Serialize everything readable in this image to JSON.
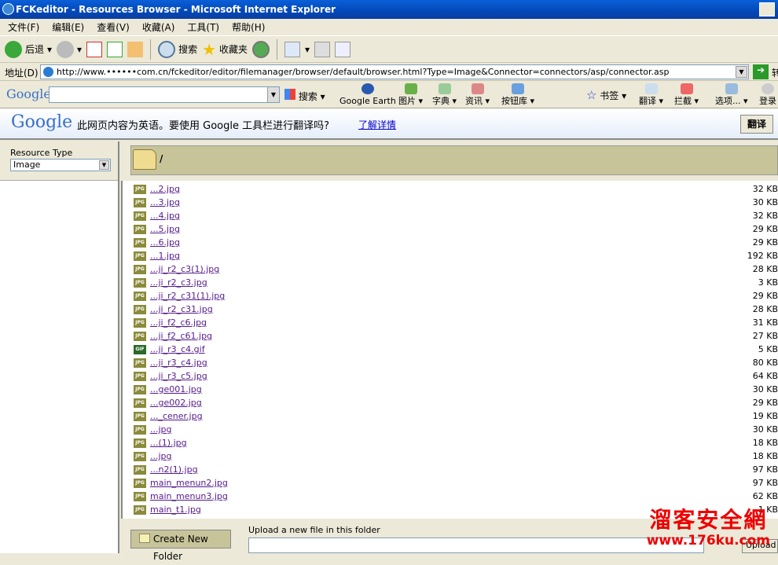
{
  "window": {
    "title": "FCKeditor - Resources Browser - Microsoft Internet Explorer"
  },
  "menu": [
    "文件(F)",
    "编辑(E)",
    "查看(V)",
    "收藏(A)",
    "工具(T)",
    "帮助(H)"
  ],
  "toolbar": {
    "back": "后退",
    "search": "搜索",
    "favorites": "收藏夹"
  },
  "address": {
    "label": "地址(D)",
    "url": "http://www.••••••com.cn/fckeditor/editor/filemanager/browser/default/browser.html?Type=Image&Connector=connectors/asp/connector.asp",
    "go": "转"
  },
  "google_toolbar": {
    "logo": "Google",
    "search": "搜索",
    "items": [
      "Google Earth",
      "图片",
      "字典",
      "资讯",
      "按钮库",
      "书签",
      "翻译",
      "拦截",
      "选项...",
      "登录"
    ]
  },
  "translate_bar": {
    "logo": "Google",
    "message": "此网页内容为英语。要使用 Google 工具栏进行翻译吗?",
    "learn_more": "了解详情",
    "button": "翻译"
  },
  "resource_type": {
    "label": "Resource Type",
    "value": "Image"
  },
  "folder": {
    "path": "/"
  },
  "files": [
    {
      "name": "...2.jpg",
      "size": "32 KB",
      "type": "JPG"
    },
    {
      "name": "...3.jpg",
      "size": "30 KB",
      "type": "JPG"
    },
    {
      "name": "...4.jpg",
      "size": "32 KB",
      "type": "JPG"
    },
    {
      "name": "...5.jpg",
      "size": "29 KB",
      "type": "JPG"
    },
    {
      "name": "...6.jpg",
      "size": "29 KB",
      "type": "JPG"
    },
    {
      "name": "...1.jpg",
      "size": "192 KB",
      "type": "JPG"
    },
    {
      "name": "...ji_r2_c3(1).jpg",
      "size": "28 KB",
      "type": "JPG"
    },
    {
      "name": "...ji_r2_c3.jpg",
      "size": "3 KB",
      "type": "JPG"
    },
    {
      "name": "...ji_r2_c31(1).jpg",
      "size": "29 KB",
      "type": "JPG"
    },
    {
      "name": "...ji_r2_c31.jpg",
      "size": "28 KB",
      "type": "JPG"
    },
    {
      "name": "...ji_f2_c6.jpg",
      "size": "31 KB",
      "type": "JPG"
    },
    {
      "name": "...ji_f2_c61.jpg",
      "size": "27 KB",
      "type": "JPG"
    },
    {
      "name": "...ji_r3_c4.gif",
      "size": "5 KB",
      "type": "GIF"
    },
    {
      "name": "...ji_r3_c4.jpg",
      "size": "80 KB",
      "type": "JPG"
    },
    {
      "name": "...ji_r3_c5.jpg",
      "size": "64 KB",
      "type": "JPG"
    },
    {
      "name": "...ge001.jpg",
      "size": "30 KB",
      "type": "JPG"
    },
    {
      "name": "...ge002.jpg",
      "size": "29 KB",
      "type": "JPG"
    },
    {
      "name": "..._cener.jpg",
      "size": "19 KB",
      "type": "JPG"
    },
    {
      "name": "...jpg",
      "size": "30 KB",
      "type": "JPG"
    },
    {
      "name": "...(1).jpg",
      "size": "18 KB",
      "type": "JPG"
    },
    {
      "name": "...jpg",
      "size": "18 KB",
      "type": "JPG"
    },
    {
      "name": "...n2(1).jpg",
      "size": "97 KB",
      "type": "JPG"
    },
    {
      "name": "main_menun2.jpg",
      "size": "97 KB",
      "type": "JPG"
    },
    {
      "name": "main_menun3.jpg",
      "size": "62 KB",
      "type": "JPG"
    },
    {
      "name": "main_t1.jpg",
      "size": "1 KB",
      "type": "JPG"
    }
  ],
  "bottom": {
    "create_folder": "Create New Folder",
    "upload_label": "Upload a new file in this folder",
    "upload_button": "Upload"
  },
  "watermark": {
    "line1": "溜客安全網",
    "line2": "www.176ku.com"
  }
}
